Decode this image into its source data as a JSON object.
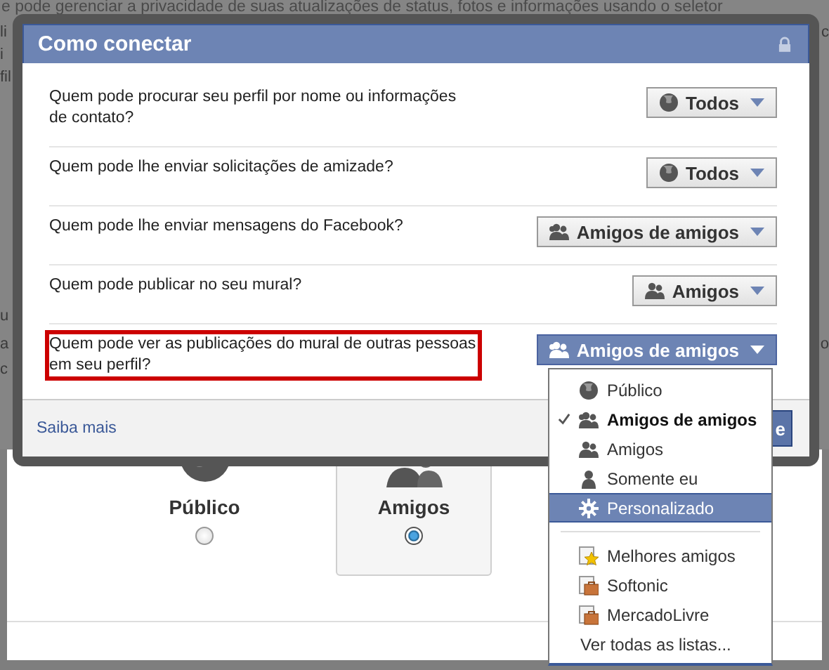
{
  "background_text": "e pode gerenciar a privacidade de suas atualizações de status, fotos e informações usando o seletor",
  "background_fragments": [
    "li",
    "c",
    "i",
    "fil",
    "u",
    "a",
    "o",
    "c"
  ],
  "dialog": {
    "title": "Como conectar",
    "rows": [
      {
        "question": "Quem pode procurar seu perfil por nome ou informações de contato?",
        "setting": {
          "label": "Todos"
        },
        "open": false,
        "highlighted": false
      },
      {
        "question": "Quem pode lhe enviar solicitações de amizade?",
        "setting": {
          "label": "Todos"
        },
        "open": false,
        "highlighted": false
      },
      {
        "question": "Quem pode lhe enviar mensagens do Facebook?",
        "setting": {
          "label": "Amigos de amigos"
        },
        "open": false,
        "highlighted": false
      },
      {
        "question": "Quem pode publicar no seu mural?",
        "setting": {
          "label": "Amigos"
        },
        "open": false,
        "highlighted": false
      },
      {
        "question": "Quem pode ver as publicações do mural de outras pessoas em seu perfil?",
        "setting": {
          "label": "Amigos de amigos"
        },
        "open": true,
        "highlighted": true
      }
    ],
    "footer": {
      "link": "Saiba mais",
      "button": "e"
    }
  },
  "menu": {
    "items": [
      {
        "kind": "option",
        "label": "Público",
        "checked": false,
        "selected": false
      },
      {
        "kind": "option",
        "label": "Amigos de amigos",
        "checked": true,
        "selected": false
      },
      {
        "kind": "option",
        "label": "Amigos",
        "checked": false,
        "selected": false
      },
      {
        "kind": "option",
        "label": "Somente eu",
        "checked": false,
        "selected": false
      },
      {
        "kind": "option",
        "label": "Personalizado",
        "checked": false,
        "selected": true
      },
      {
        "kind": "separator"
      },
      {
        "kind": "list",
        "label": "Melhores amigos"
      },
      {
        "kind": "list",
        "label": "Softonic"
      },
      {
        "kind": "list",
        "label": "MercadoLivre"
      },
      {
        "kind": "link",
        "label": "Ver todas as listas..."
      }
    ]
  },
  "audience_options": [
    {
      "label": "Público",
      "selected": false
    },
    {
      "label": "Amigos",
      "selected": true
    }
  ]
}
